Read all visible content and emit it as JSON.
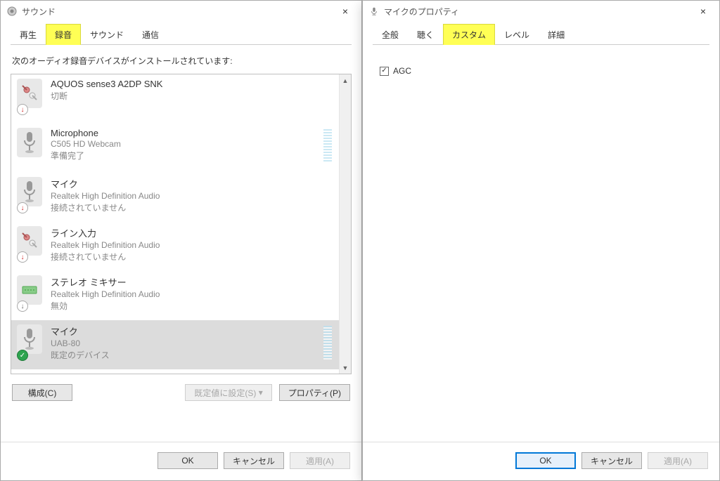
{
  "sound": {
    "title": "サウンド",
    "close_x": "×",
    "tabs": {
      "playback": "再生",
      "recording": "録音",
      "sounds": "サウンド",
      "comm": "通信"
    },
    "instruction": "次のオーディオ録音デバイスがインストールされています:",
    "devices": [
      {
        "name": "AQUOS sense3 A2DP SNK",
        "desc": "",
        "status": "切断",
        "overlay": "red",
        "vu": false
      },
      {
        "name": "Microphone",
        "desc": "C505 HD Webcam",
        "status": "準備完了",
        "overlay": "",
        "vu": true
      },
      {
        "name": "マイク",
        "desc": "Realtek High Definition Audio",
        "status": "接続されていません",
        "overlay": "red",
        "vu": false
      },
      {
        "name": "ライン入力",
        "desc": "Realtek High Definition Audio",
        "status": "接続されていません",
        "overlay": "red",
        "vu": false
      },
      {
        "name": "ステレオ ミキサー",
        "desc": "Realtek High Definition Audio",
        "status": "無効",
        "overlay": "gray",
        "vu": false
      },
      {
        "name": "マイク",
        "desc": "UAB-80",
        "status": "既定のデバイス",
        "overlay": "green",
        "vu": true,
        "selected": true
      }
    ],
    "buttons": {
      "configure": "構成(C)",
      "set_default": "既定値に設定(S)",
      "dropdown": "▾",
      "properties": "プロパティ(P)"
    },
    "footer": {
      "ok": "OK",
      "cancel": "キャンセル",
      "apply": "適用(A)"
    }
  },
  "mic": {
    "title": "マイクのプロパティ",
    "close_x": "×",
    "tabs": {
      "general": "全般",
      "listen": "聴く",
      "custom": "カスタム",
      "levels": "レベル",
      "advanced": "詳細"
    },
    "checkbox": {
      "agc_label": "AGC",
      "agc_checked": "✓"
    },
    "footer": {
      "ok": "OK",
      "cancel": "キャンセル",
      "apply": "適用(A)"
    }
  }
}
